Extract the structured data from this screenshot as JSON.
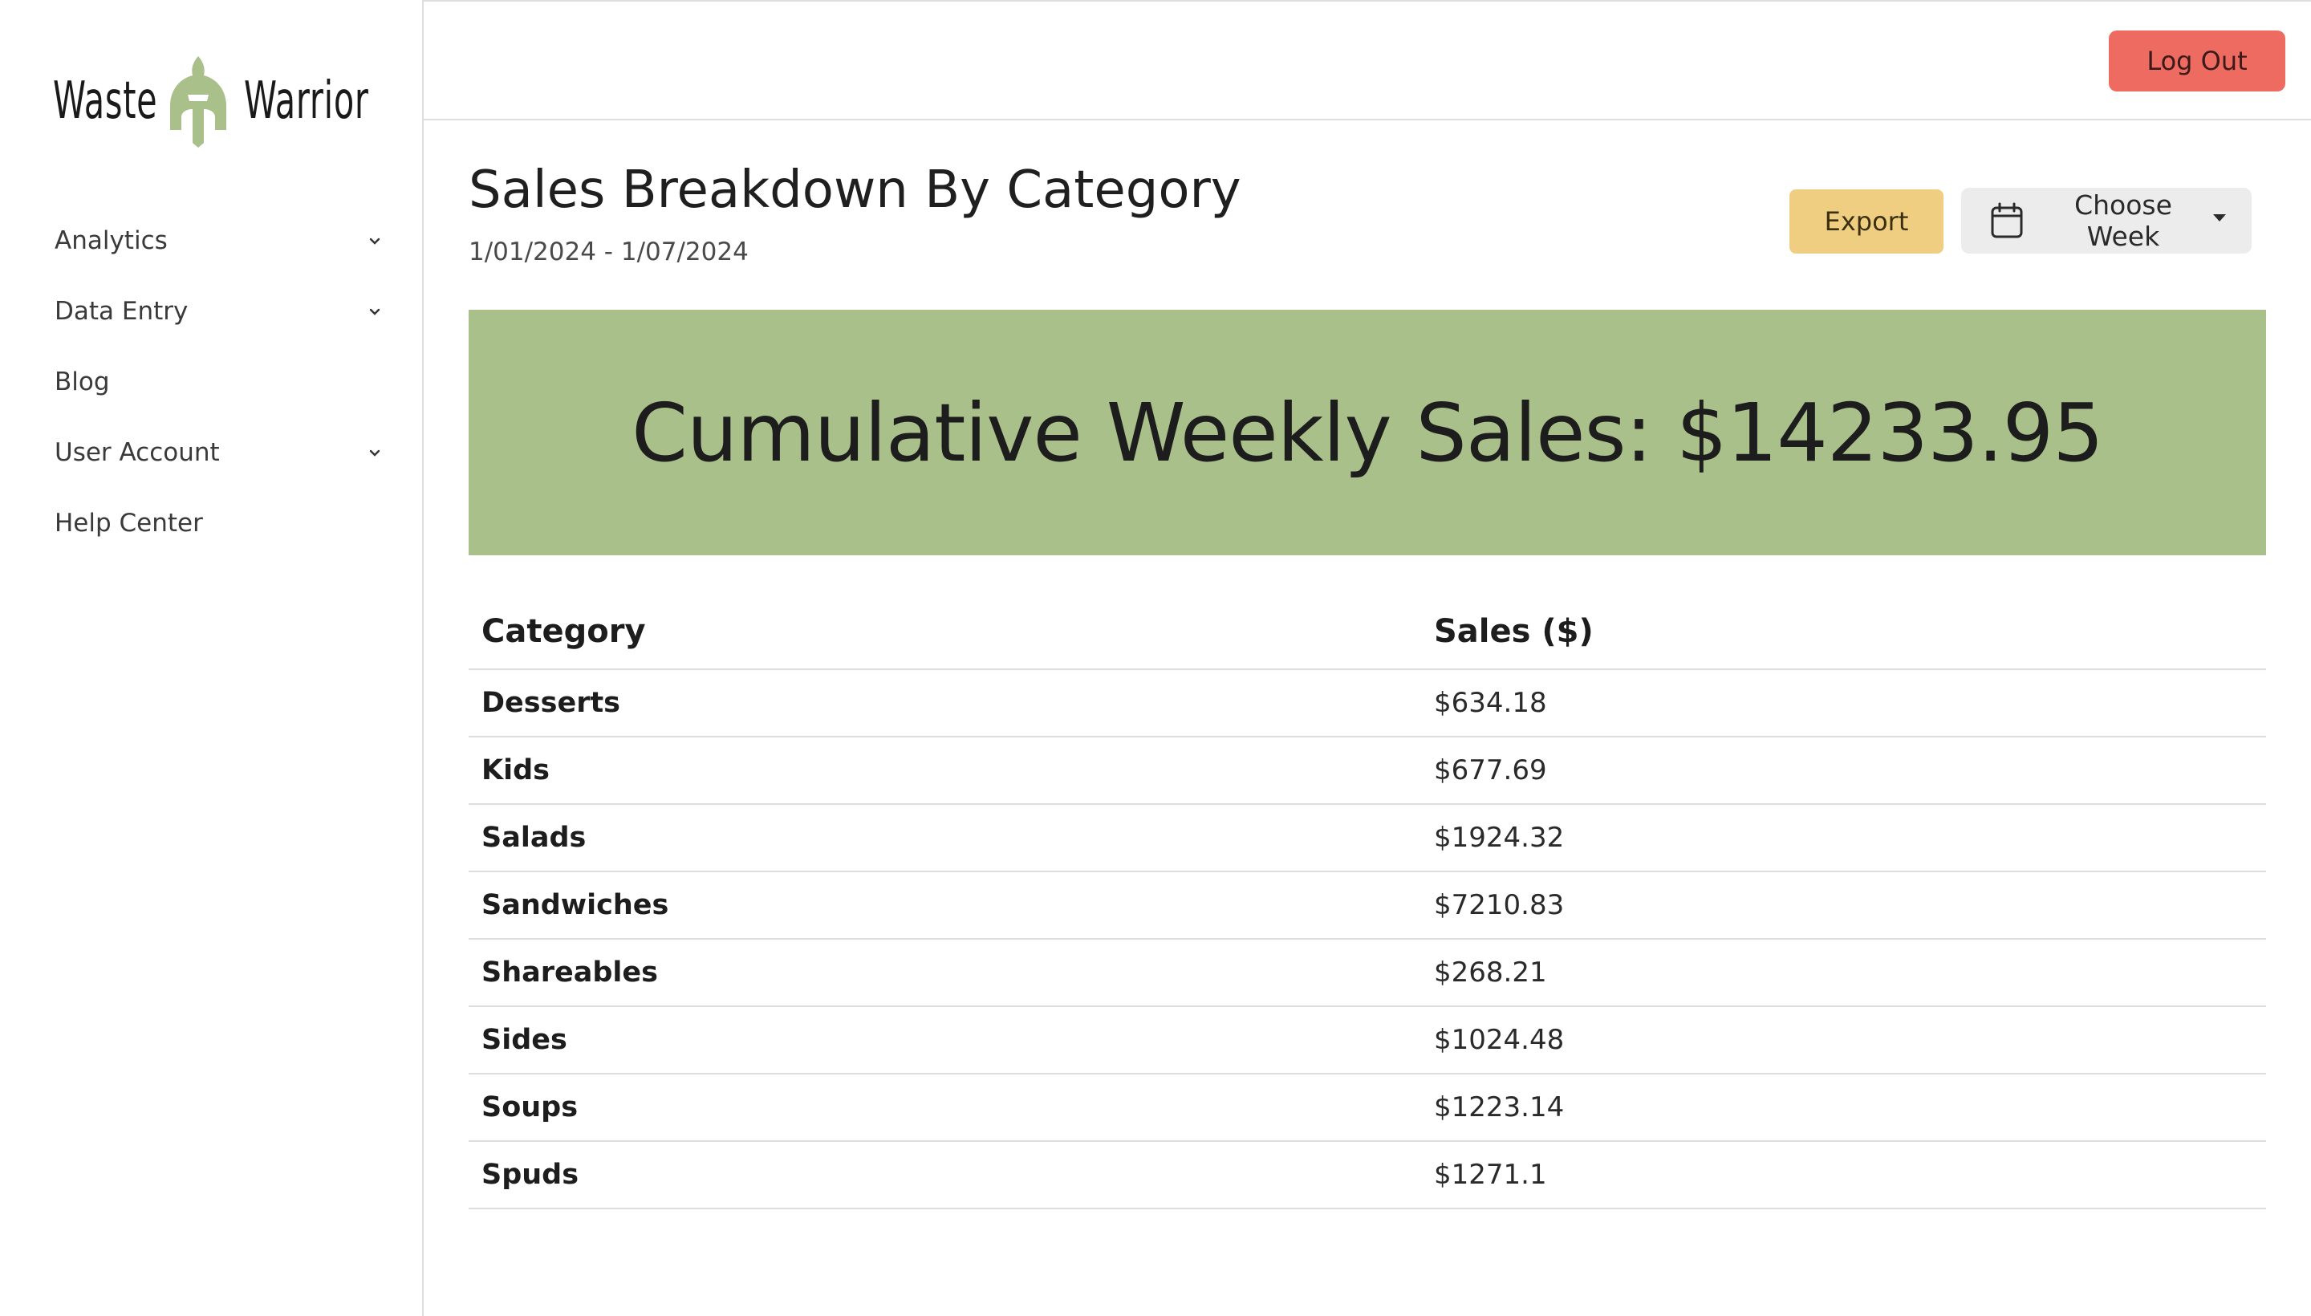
{
  "brand": {
    "name_left": "Waste",
    "name_right": "Warrior",
    "accent_color": "#a9c08a"
  },
  "sidebar": {
    "items": [
      {
        "label": "Analytics",
        "has_submenu": true,
        "icon": "chevron-down-icon"
      },
      {
        "label": "Data Entry",
        "has_submenu": true,
        "icon": "chevron-down-icon"
      },
      {
        "label": "Blog",
        "has_submenu": false
      },
      {
        "label": "User Account",
        "has_submenu": true,
        "icon": "chevron-down-icon"
      },
      {
        "label": "Help Center",
        "has_submenu": false
      }
    ]
  },
  "header": {
    "logout_label": "Log Out",
    "logout_color": "#ee6b61"
  },
  "page": {
    "title": "Sales Breakdown By Category",
    "date_range": "1/01/2024 - 1/07/2024",
    "export_label": "Export",
    "export_color": "#efcd81",
    "week_picker_label": "Choose Week",
    "week_picker_icon": "calendar-icon"
  },
  "summary": {
    "text": "Cumulative Weekly Sales: $14233.95",
    "background": "#a9c08a"
  },
  "table": {
    "headers": [
      "Category",
      "Sales ($)"
    ],
    "rows": [
      {
        "category": "Desserts",
        "sales": "$634.18"
      },
      {
        "category": "Kids",
        "sales": "$677.69"
      },
      {
        "category": "Salads",
        "sales": "$1924.32"
      },
      {
        "category": "Sandwiches",
        "sales": "$7210.83"
      },
      {
        "category": "Shareables",
        "sales": "$268.21"
      },
      {
        "category": "Sides",
        "sales": "$1024.48"
      },
      {
        "category": "Soups",
        "sales": "$1223.14"
      },
      {
        "category": "Spuds",
        "sales": "$1271.1"
      }
    ]
  }
}
